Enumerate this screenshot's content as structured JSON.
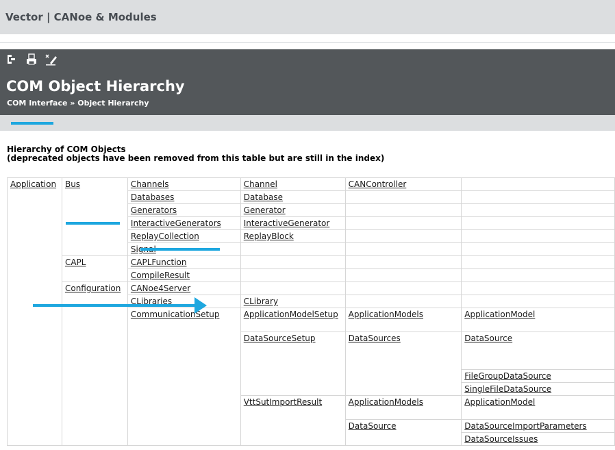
{
  "app": {
    "title": "Vector | CANoe & Modules"
  },
  "toolbar": {
    "icons": [
      "toc-icon",
      "print-icon",
      "clear-highlight-icon"
    ]
  },
  "page": {
    "title": "COM Object Hierarchy",
    "breadcrumb": {
      "parent": "COM Interface",
      "separator": "»",
      "current": "Object Hierarchy"
    }
  },
  "section": {
    "heading": "Hierarchy of COM Objects",
    "subheading": "(deprecated objects have been removed from this table but are still in the index)"
  },
  "table": {
    "r1": [
      "Application",
      "Bus",
      "Channels",
      "Channel",
      "CANController"
    ],
    "r2": [
      "Databases",
      "Database"
    ],
    "r3": [
      "Generators",
      "Generator"
    ],
    "r4": [
      "InteractiveGenerators",
      "InteractiveGenerator"
    ],
    "r5": [
      "ReplayCollection",
      "ReplayBlock"
    ],
    "r6": [
      "Signal"
    ],
    "r7": [
      "CAPL",
      "CAPLFunction"
    ],
    "r8": [
      "CompileResult"
    ],
    "r9": [
      "Configuration",
      "CANoe4Server"
    ],
    "r10": [
      "CLibraries",
      "CLibrary"
    ],
    "r11": [
      "CommunicationSetup",
      "ApplicationModelSetup",
      "ApplicationModels",
      "ApplicationModel"
    ],
    "r12": [
      "DataSourceSetup",
      "DataSources",
      "DataSource"
    ],
    "r13": [
      "FileGroupDataSource"
    ],
    "r14": [
      "SingleFileDataSource"
    ],
    "r15": [
      "VttSutImportResult",
      "ApplicationModels",
      "ApplicationModel"
    ],
    "r16": [
      "DataSource",
      "DataSourceImportParameters"
    ],
    "r17": [
      "DataSourceIssues"
    ]
  },
  "colors": {
    "accent": "#1ea7df",
    "header_bg": "#53575a",
    "bar_bg": "#dcdee0"
  }
}
